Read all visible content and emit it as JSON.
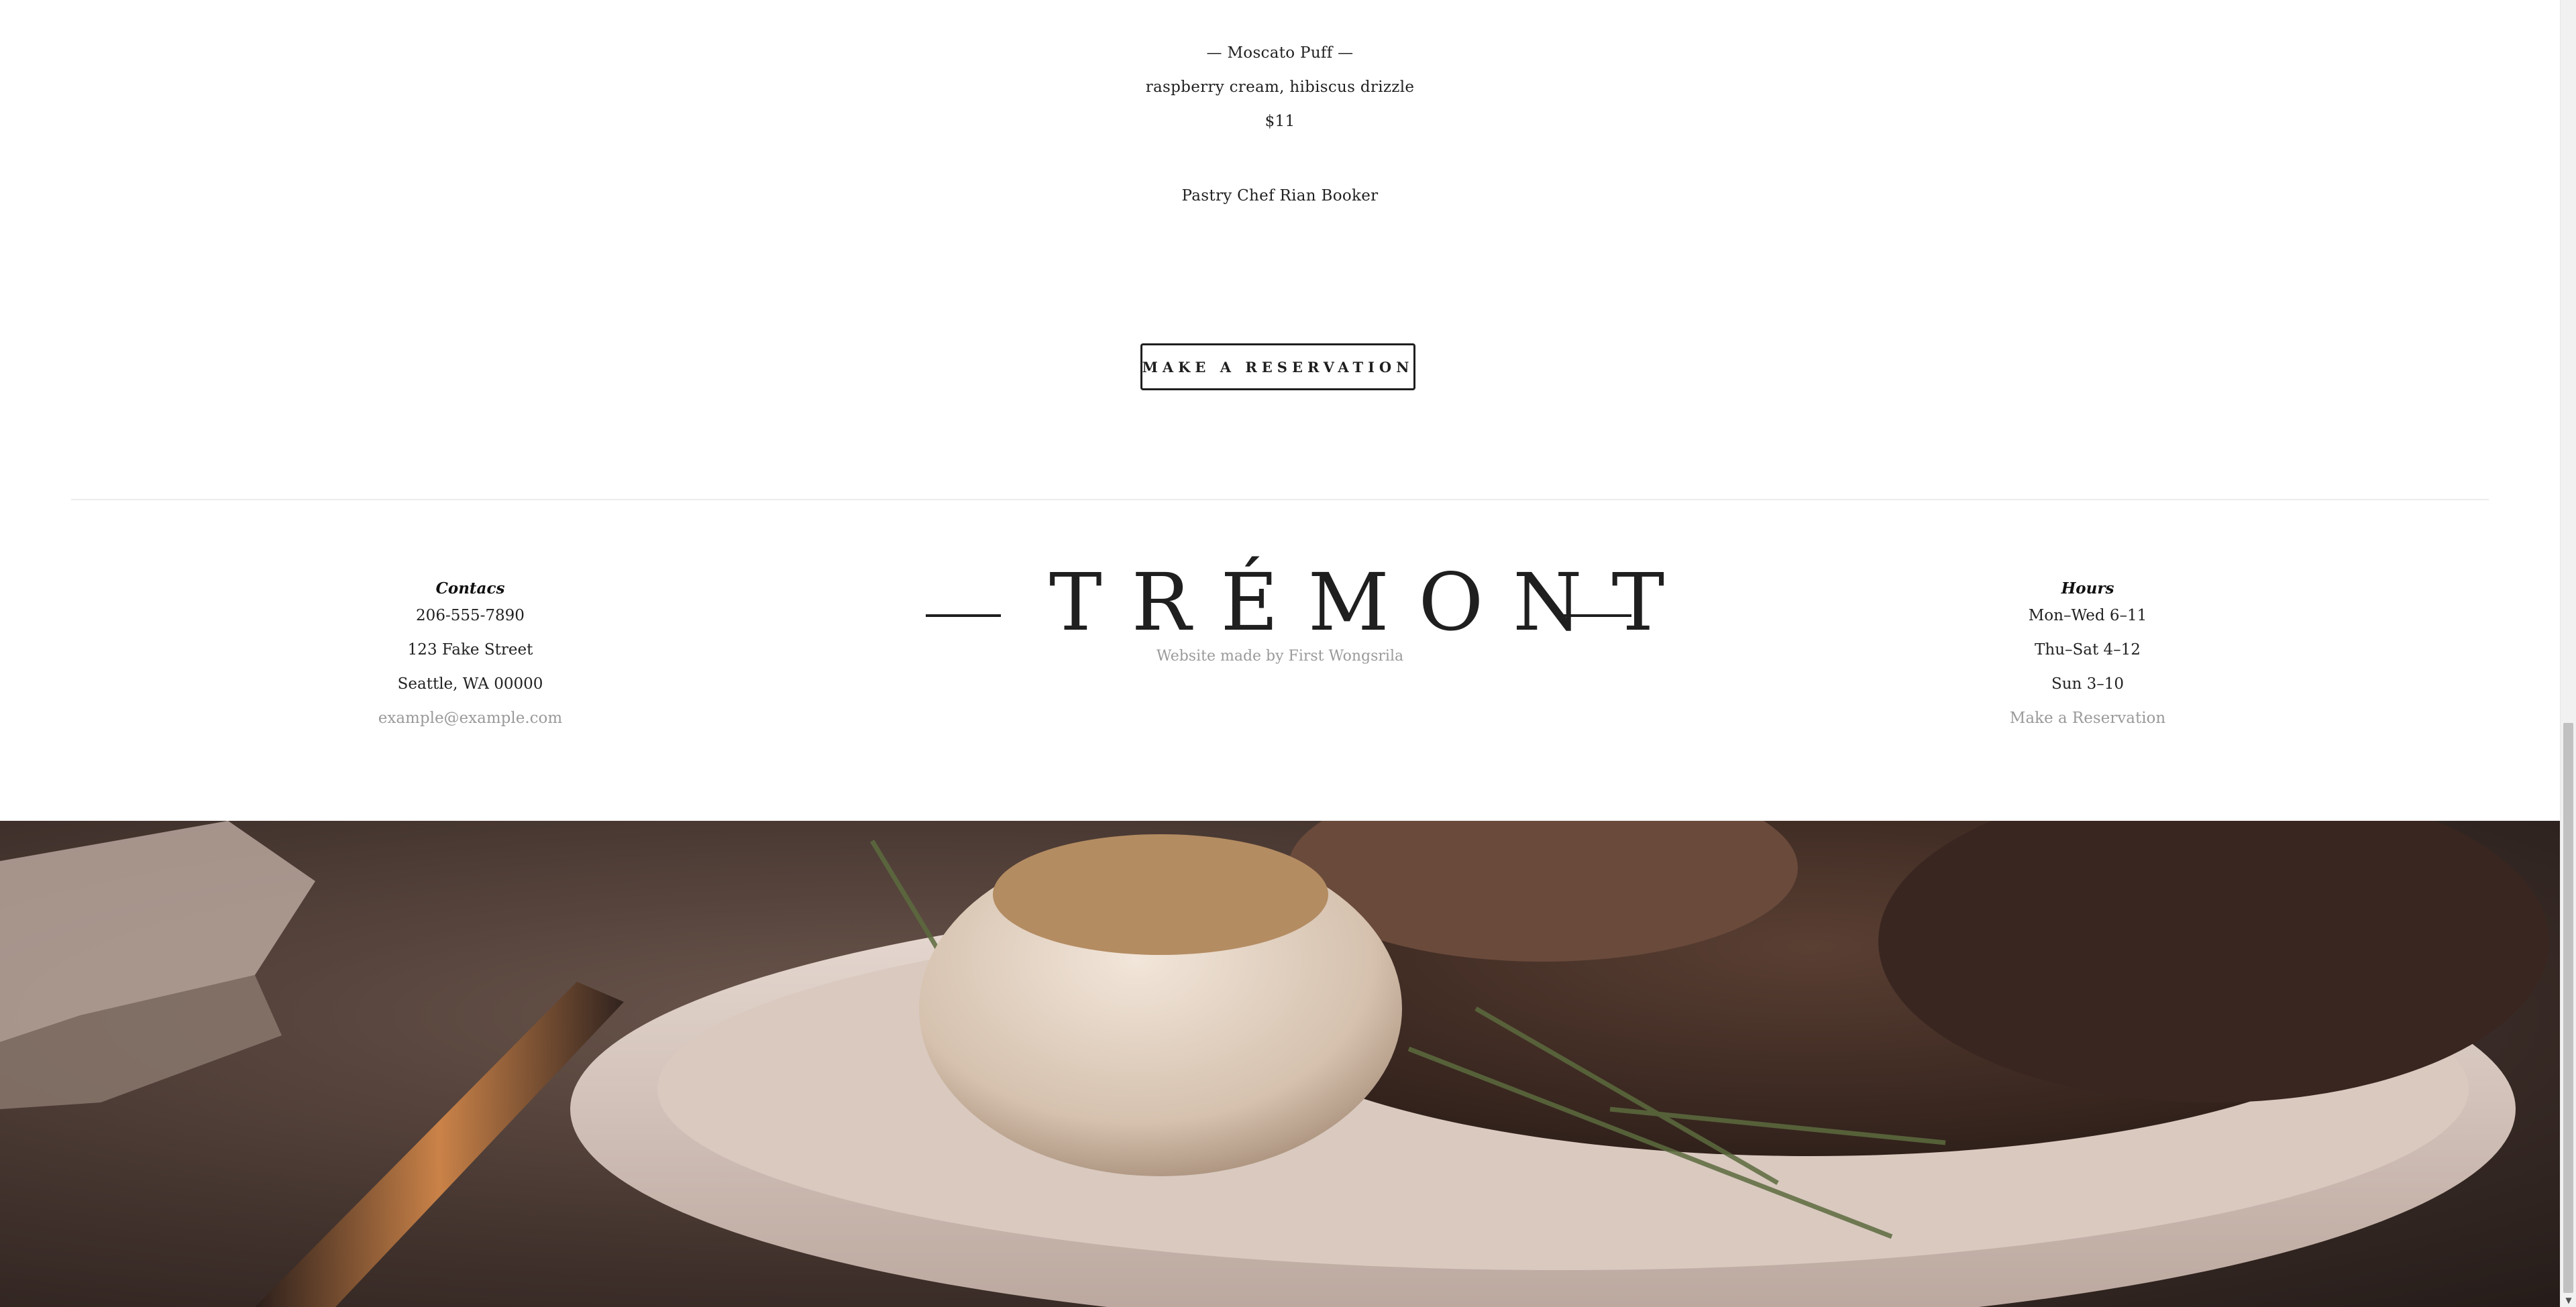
{
  "menu": {
    "item_title": "— Moscato Puff —",
    "item_description": "raspberry cream, hibiscus drizzle",
    "item_price": "$11",
    "chef": "Pastry Chef Rian Booker"
  },
  "cta": {
    "reservation_label": "MAKE A RESERVATION"
  },
  "footer": {
    "contacts": {
      "heading": "Contacs",
      "phone": "206-555-7890",
      "street": "123 Fake Street",
      "city": "Seattle, WA 00000",
      "email": "example@example.com"
    },
    "brand": {
      "logo": "TRÉMONT",
      "credit": "Website made by First Wongsrila"
    },
    "hours": {
      "heading": "Hours",
      "line1": "Mon–Wed 6–11",
      "line2": "Thu–Sat 4–12",
      "line3": "Sun 3–10",
      "reservation_link": "Make a Reservation"
    }
  },
  "image": {
    "subject": "plated dish with roasted garlic and rosemary, fork at left"
  },
  "colors": {
    "text": "#1f1f1f",
    "muted": "#9a9a9a",
    "divider": "#ececec",
    "background": "#ffffff"
  }
}
